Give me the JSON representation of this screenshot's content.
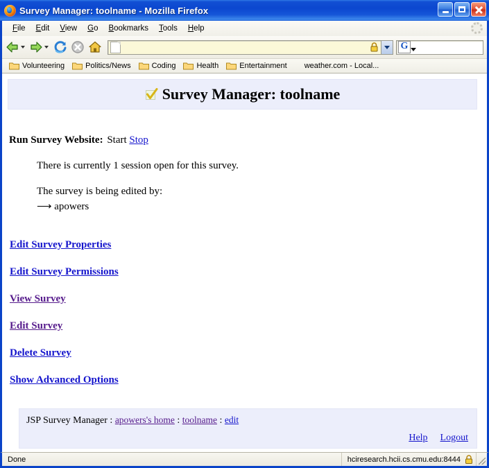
{
  "window": {
    "title": "Survey Manager: toolname - Mozilla Firefox",
    "app_icon": "firefox-icon",
    "minimize_label": "Minimize",
    "maximize_label": "Maximize",
    "close_label": "Close"
  },
  "menubar": {
    "items": [
      {
        "label": "File",
        "accel": "F"
      },
      {
        "label": "Edit",
        "accel": "E"
      },
      {
        "label": "View",
        "accel": "V"
      },
      {
        "label": "Go",
        "accel": "G"
      },
      {
        "label": "Bookmarks",
        "accel": "B"
      },
      {
        "label": "Tools",
        "accel": "T"
      },
      {
        "label": "Help",
        "accel": "H"
      }
    ],
    "throbber": "activity-indicator-icon"
  },
  "navbar": {
    "back": "back-arrow-icon",
    "forward": "forward-arrow-icon",
    "reload": "reload-icon",
    "stop": "stop-icon",
    "home": "home-icon",
    "url_value": "",
    "url_placeholder": "",
    "url_favicon": "page-favicon",
    "url_lock": "lock-icon",
    "url_dropdown": "chevron-down-icon",
    "search_value": "",
    "search_placeholder": "",
    "search_engine": "Google"
  },
  "bookmarks": {
    "items": [
      {
        "label": "Volunteering",
        "icon": "folder-icon"
      },
      {
        "label": "Politics/News",
        "icon": "folder-icon"
      },
      {
        "label": "Coding",
        "icon": "folder-icon"
      },
      {
        "label": "Health",
        "icon": "folder-icon"
      },
      {
        "label": "Entertainment",
        "icon": "folder-icon"
      }
    ],
    "plain": "weather.com - Local..."
  },
  "page": {
    "header": {
      "icon": "checkmark-icon",
      "title": "Survey Manager: toolname"
    },
    "run": {
      "label": "Run Survey Website:",
      "start_label": "Start",
      "stop_label": "Stop"
    },
    "session_info": "There is currently 1 session open for this survey.",
    "edited_by_label": "The survey is being edited by:",
    "editor_arrow": "⟶",
    "editor_name": "apowers",
    "actions": [
      {
        "label": "Edit Survey Properties",
        "visited": false
      },
      {
        "label": "Edit Survey Permissions",
        "visited": false
      },
      {
        "label": "View Survey",
        "visited": true
      },
      {
        "label": "Edit Survey",
        "visited": true
      },
      {
        "label": "Delete Survey",
        "visited": false
      },
      {
        "label": "Show Advanced Options",
        "visited": false
      }
    ],
    "footer": {
      "brand": "JSP Survey Manager",
      "sep": ":",
      "crumb_home": "apowers's home",
      "crumb_tool": "toolname",
      "crumb_edit": "edit",
      "help_label": "Help",
      "logout_label": "Logout"
    }
  },
  "statusbar": {
    "status_text": "Done",
    "host": "hciresearch.hcii.cs.cmu.edu:8444",
    "lock": "lock-icon"
  },
  "colors": {
    "titlebar_blue": "#0b47cf",
    "window_border": "#0a43c8",
    "link_blue": "#1414cc",
    "link_visited": "#551a8b",
    "panel_lavender": "#eceefb",
    "urlbar_yellow": "#fbf8d8"
  }
}
